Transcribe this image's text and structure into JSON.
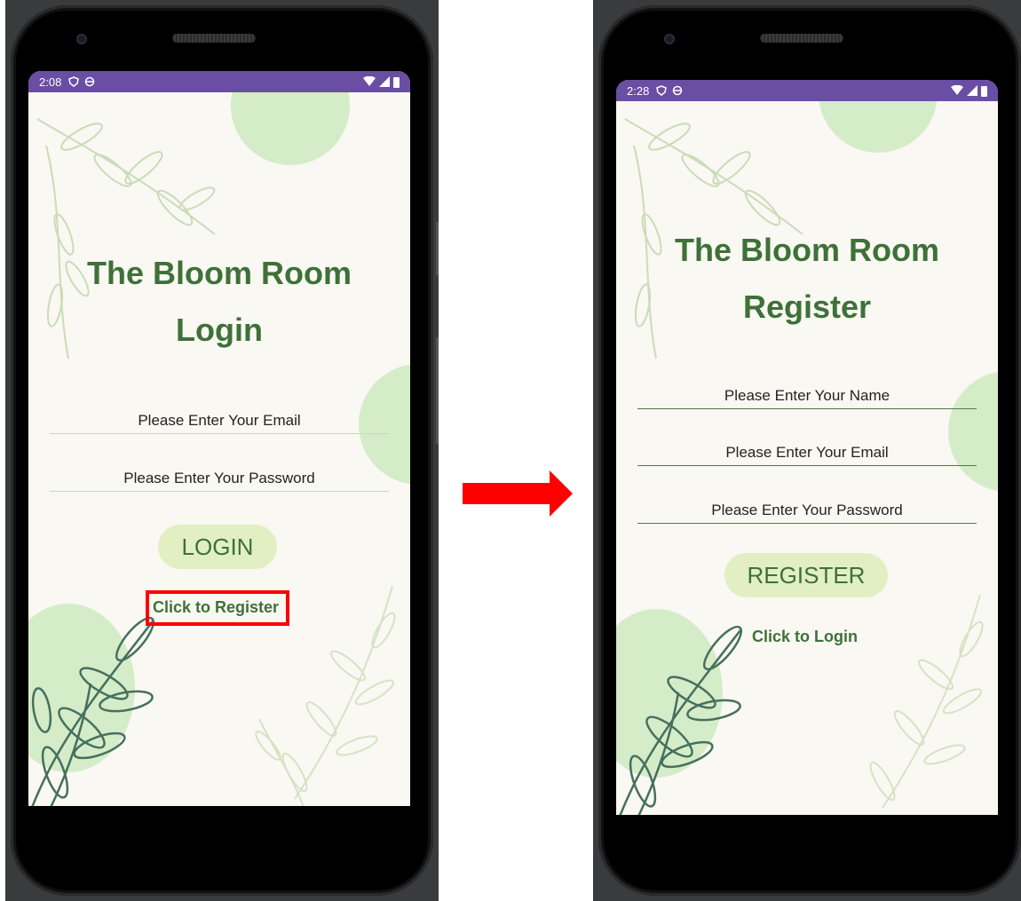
{
  "left_screen": {
    "status": {
      "time": "2:08"
    },
    "title_line1": "The Bloom Room",
    "title_line2": "Login",
    "email_placeholder": "Please Enter Your Email",
    "password_placeholder": "Please Enter Your Password",
    "button_label": "LOGIN",
    "link_label": "Click to Register"
  },
  "right_screen": {
    "status": {
      "time": "2:28"
    },
    "title_line1": "The Bloom Room",
    "title_line2": "Register",
    "name_placeholder": "Please Enter Your Name",
    "email_placeholder": "Please Enter Your Email",
    "password_placeholder": "Please Enter Your Password",
    "button_label": "REGISTER",
    "link_label": "Click to Login"
  },
  "colors": {
    "status_bar": "#6a4ea3",
    "screen_bg": "#faf8f2",
    "accent_green": "#3e7139",
    "button_bg": "#e2efc2",
    "deco_circle": "#d5ecc9",
    "highlight": "#ff0000",
    "arrow": "#ff0000"
  }
}
